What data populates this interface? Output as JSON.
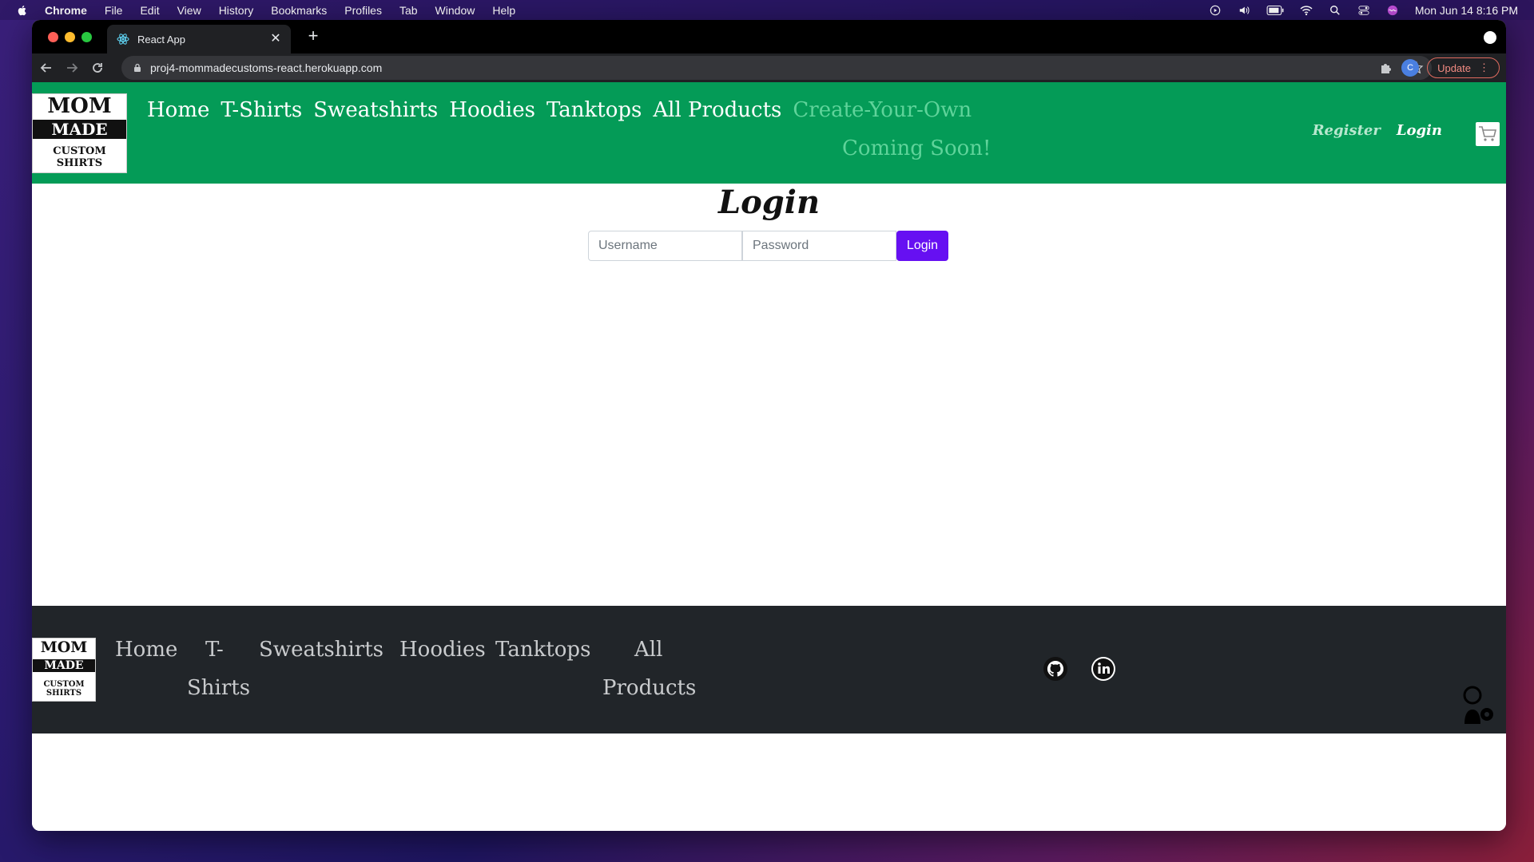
{
  "menubar": {
    "app": "Chrome",
    "items": [
      "File",
      "Edit",
      "View",
      "History",
      "Bookmarks",
      "Profiles",
      "Tab",
      "Window",
      "Help"
    ],
    "clock": "Mon Jun 14  8:16 PM"
  },
  "browser": {
    "tab_title": "React App",
    "url": "proj4-mommadecustoms-react.herokuapp.com",
    "profile_initial": "C",
    "update_label": "Update"
  },
  "header": {
    "nav": [
      "Home",
      "T-Shirts",
      "Sweatshirts",
      "Hoodies",
      "Tanktops",
      "All Products"
    ],
    "create_your_own": "Create-Your-Own",
    "coming_soon": "Coming Soon!",
    "register": "Register",
    "login": "Login"
  },
  "login": {
    "title": "Login",
    "username_placeholder": "Username",
    "password_placeholder": "Password",
    "button": "Login"
  },
  "footer": {
    "home": "Home",
    "tshirts_1": "T-",
    "tshirts_2": "Shirts",
    "sweatshirts": "Sweatshirts",
    "hoodies": "Hoodies",
    "tanktops": "Tanktops",
    "all_1": "All",
    "all_2": "Products"
  },
  "logo_text": [
    "MOM",
    "MADE",
    "CUSTOM SHIRTS"
  ],
  "icons": {
    "github": "github-icon",
    "linkedin": "linkedin-icon",
    "cart": "cart-icon"
  },
  "colors": {
    "header_bg": "#049b57",
    "footer_bg": "#212529",
    "login_button": "#6610f2"
  }
}
